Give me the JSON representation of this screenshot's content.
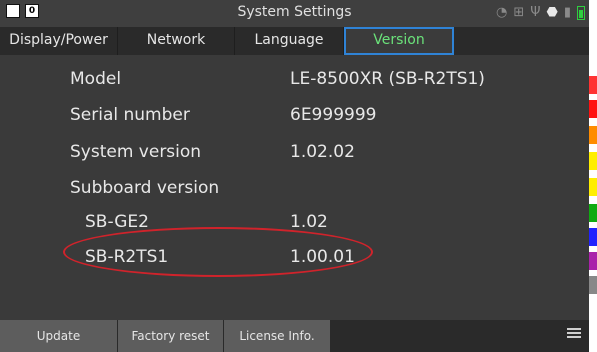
{
  "titlebar": {
    "title": "System Settings",
    "left_box_label": "0"
  },
  "tabs": [
    {
      "label": "Display/Power",
      "active": false
    },
    {
      "label": "Network",
      "active": false
    },
    {
      "label": "Language",
      "active": false
    },
    {
      "label": "Version",
      "active": true
    }
  ],
  "info": {
    "model_label": "Model",
    "model_value": "LE-8500XR (SB-R2TS1)",
    "serial_label": "Serial number",
    "serial_value": "6E999999",
    "sysver_label": "System version",
    "sysver_value": "1.02.02",
    "subboard_label": "Subboard version",
    "sub1_label": "SB-GE2",
    "sub1_value": "1.02",
    "sub2_label": "SB-R2TS1",
    "sub2_value": "1.00.01"
  },
  "bottom": {
    "update_label": "Update",
    "factory_label": "Factory reset",
    "license_label": "License Info."
  },
  "colors": {
    "accent_active_tab_text": "#6be27a",
    "active_tab_border": "#2f83d6",
    "highlight_ellipse": "#d0232b",
    "strip": [
      "#ff0000",
      "#ff0000",
      "#ff8800",
      "#ffff00",
      "#00aa00",
      "#0000ff",
      "#aa00aa",
      "#888888",
      "#ffffff"
    ]
  },
  "icons": {
    "status": [
      "wifi-icon",
      "network-icon",
      "usb-icon",
      "usb-drive-icon",
      "sd-card-icon",
      "battery-icon"
    ],
    "menu": "menu-icon"
  }
}
